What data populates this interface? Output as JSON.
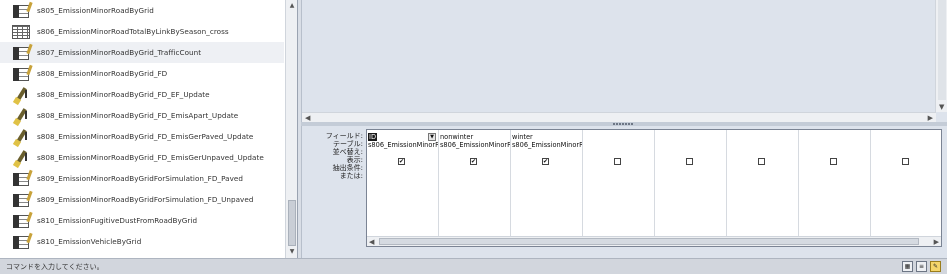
{
  "nav": {
    "items": [
      {
        "label": "s805_EmissionMinorRoadByGrid",
        "icon": "query-icon"
      },
      {
        "label": "s806_EmissionMinorRoadTotalByLinkBySeason_cross",
        "icon": "table-icon"
      },
      {
        "label": "s807_EmissionMinorRoadByGrid_TrafficCount",
        "icon": "query-icon",
        "selected": true
      },
      {
        "label": "s808_EmissionMinorRoadByGrid_FD",
        "icon": "query-icon"
      },
      {
        "label": "s808_EmissionMinorRoadByGrid_FD_EF_Update",
        "icon": "update-icon"
      },
      {
        "label": "s808_EmissionMinorRoadByGrid_FD_EmisApart_Update",
        "icon": "update-icon"
      },
      {
        "label": "s808_EmissionMinorRoadByGrid_FD_EmisGerPaved_Update",
        "icon": "update-icon"
      },
      {
        "label": "s808_EmissionMinorRoadByGrid_FD_EmisGerUnpaved_Update",
        "icon": "update-icon"
      },
      {
        "label": "s809_EmissionMinorRoadByGridForSimulation_FD_Paved",
        "icon": "query-icon"
      },
      {
        "label": "s809_EmissionMinorRoadByGridForSimulation_FD_Unpaved",
        "icon": "query-icon"
      },
      {
        "label": "s810_EmissionFugitiveDustFromRoadByGrid",
        "icon": "query-icon"
      },
      {
        "label": "s810_EmissionVehicleByGrid",
        "icon": "query-icon"
      }
    ]
  },
  "qbe": {
    "row_labels": [
      "フィールド:",
      "テーブル:",
      "並べ替え:",
      "表示:",
      "抽出条件:",
      "または:"
    ],
    "columns": [
      {
        "field": "ID",
        "table": "s806_EmissionMinorR",
        "show": true,
        "selected": true
      },
      {
        "field": "nonwinter",
        "table": "s806_EmissionMinorR",
        "show": true
      },
      {
        "field": "winter",
        "table": "s806_EmissionMinorR",
        "show": true
      },
      {
        "field": "",
        "table": "",
        "show": false
      },
      {
        "field": "",
        "table": "",
        "show": false
      },
      {
        "field": "",
        "table": "",
        "show": false
      },
      {
        "field": "",
        "table": "",
        "show": false
      },
      {
        "field": "",
        "table": "",
        "show": false
      }
    ]
  },
  "status": {
    "text": "コマンドを入力してください。"
  }
}
